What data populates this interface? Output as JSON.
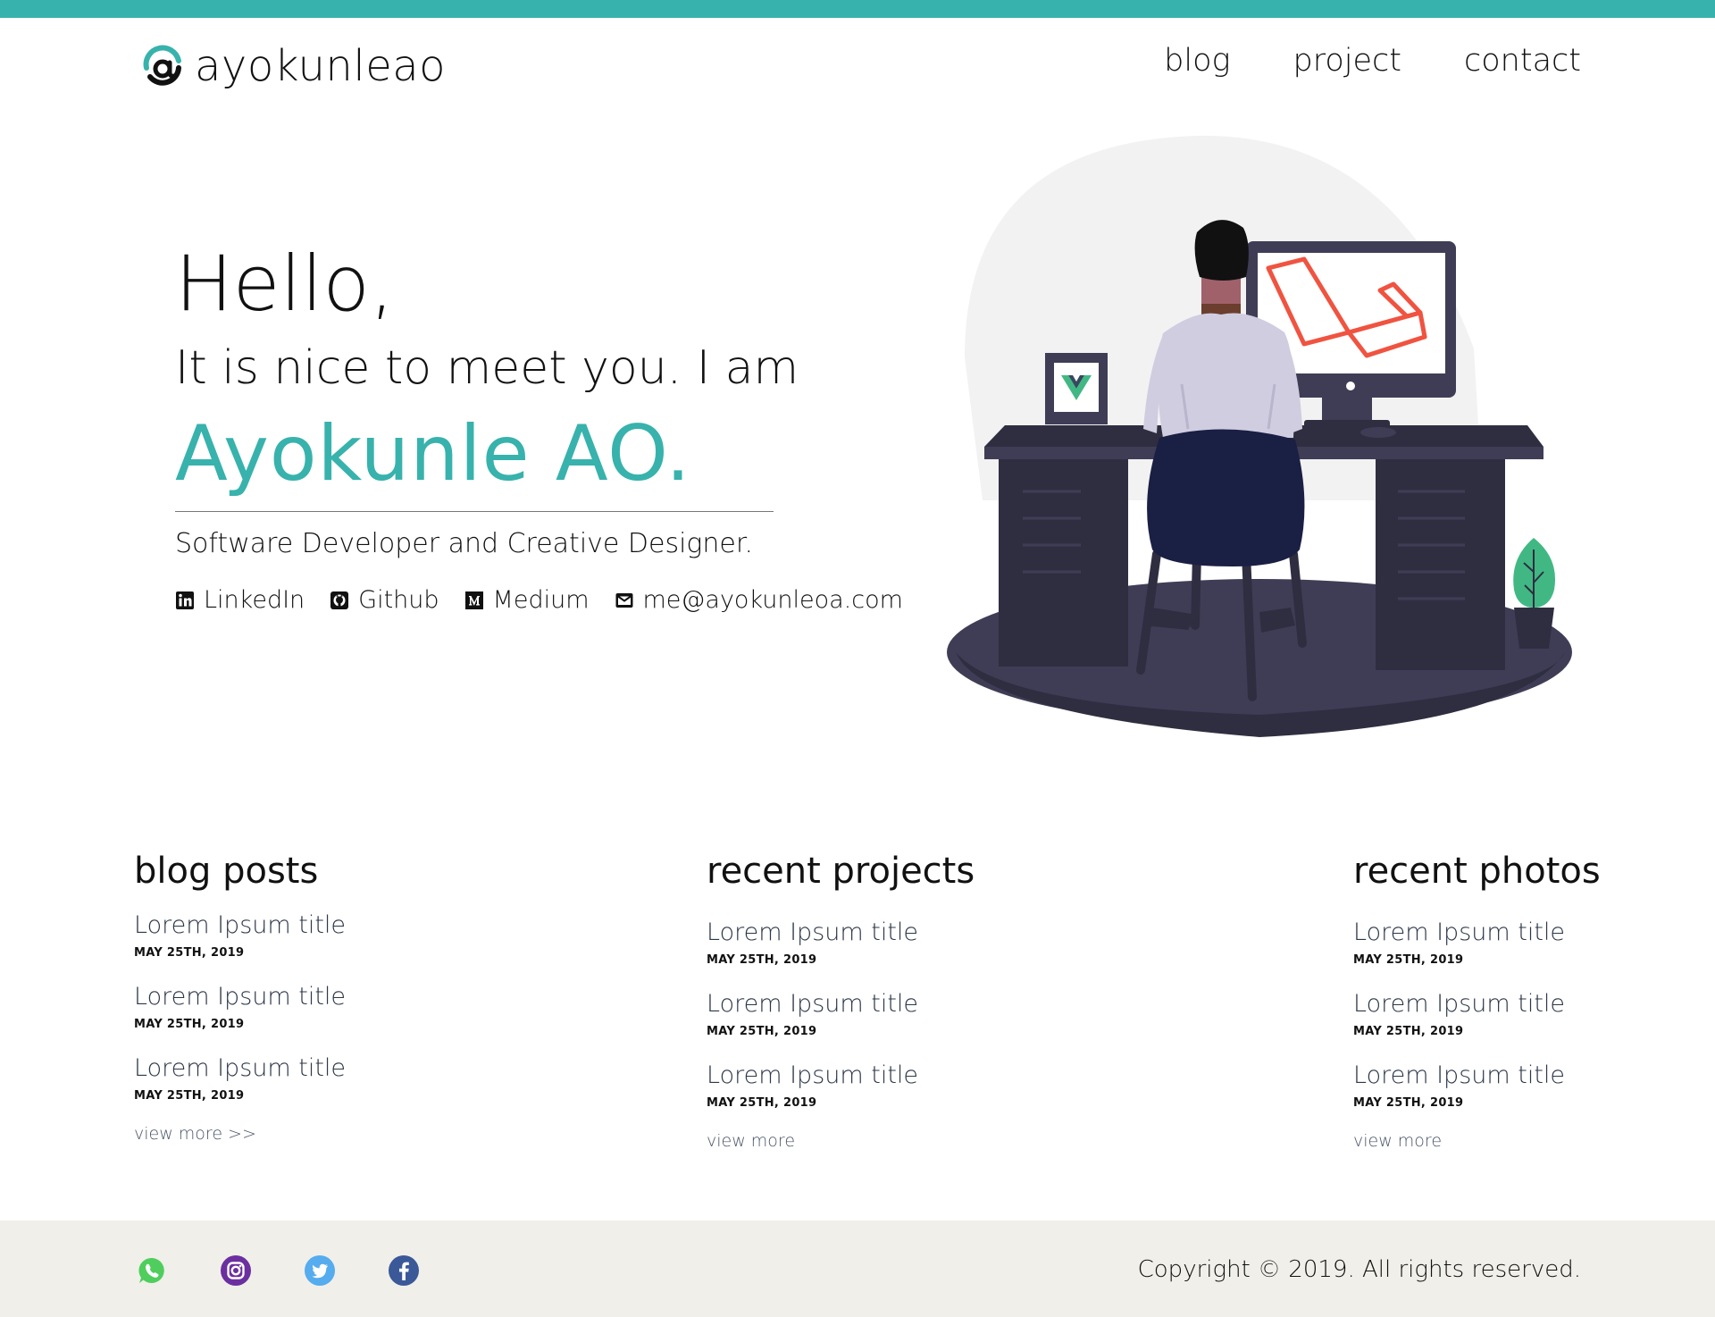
{
  "brand": {
    "name": "ayokunleao",
    "accent": "#38b2ac"
  },
  "nav": {
    "items": [
      "blog",
      "project",
      "contact"
    ]
  },
  "hero": {
    "greeting": "Hello,",
    "intro": "It is nice to meet you. I am",
    "name": "Ayokunle AO.",
    "role": "Software Developer and Creative Designer.",
    "links": {
      "linkedin": "LinkedIn",
      "github": "Github",
      "medium": "Medium",
      "email": "me@ayokunleoa.com"
    }
  },
  "sections": {
    "blog": {
      "heading": "blog posts",
      "items": [
        {
          "title": "Lorem Ipsum title",
          "date": "MAY 25TH, 2019"
        },
        {
          "title": "Lorem Ipsum title",
          "date": "MAY 25TH, 2019"
        },
        {
          "title": "Lorem Ipsum title",
          "date": "MAY 25TH, 2019"
        }
      ],
      "view_more": "view more >>"
    },
    "projects": {
      "heading": "recent projects",
      "items": [
        {
          "title": "Lorem Ipsum title",
          "date": "MAY 25TH, 2019"
        },
        {
          "title": "Lorem Ipsum title",
          "date": "MAY 25TH, 2019"
        },
        {
          "title": "Lorem Ipsum title",
          "date": "MAY 25TH, 2019"
        }
      ],
      "view_more": "view more"
    },
    "photos": {
      "heading": "recent photos",
      "items": [
        {
          "title": "Lorem Ipsum title",
          "date": "MAY 25TH, 2019"
        },
        {
          "title": "Lorem Ipsum title",
          "date": "MAY 25TH, 2019"
        },
        {
          "title": "Lorem Ipsum title",
          "date": "MAY 25TH, 2019"
        }
      ],
      "view_more": "view more"
    }
  },
  "footer": {
    "icons": [
      "whatsapp-icon",
      "instagram-icon",
      "twitter-icon",
      "facebook-icon"
    ],
    "copyright": "Copyright © 2019. All rights reserved."
  }
}
